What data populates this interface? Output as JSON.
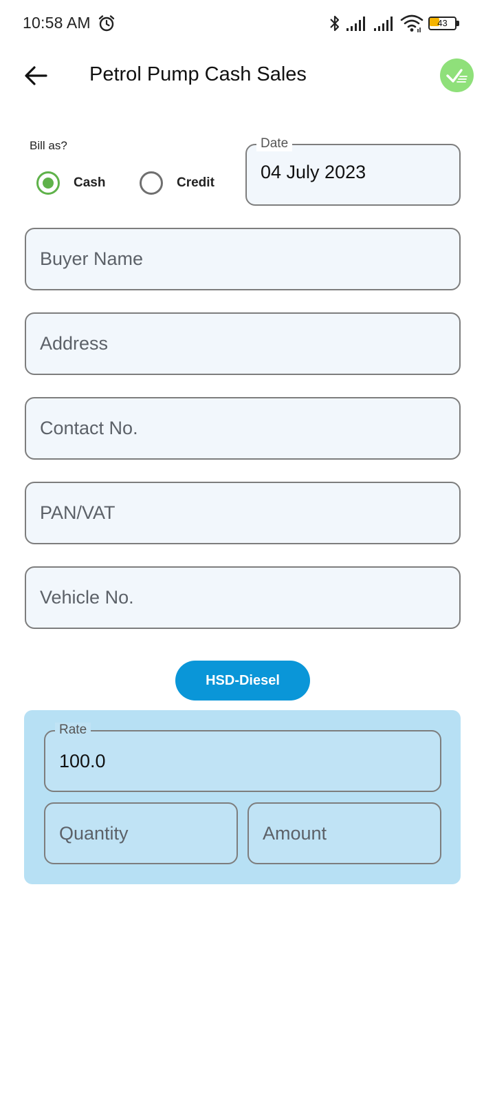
{
  "status_bar": {
    "time": "10:58 AM",
    "battery_level": "43",
    "battery_fraction": 0.43,
    "icons": [
      "alarm-icon",
      "bluetooth-icon",
      "signal-icon",
      "signal-icon",
      "wifi-icon",
      "battery-icon"
    ]
  },
  "app_bar": {
    "title": "Petrol Pump Cash Sales",
    "back_icon": "arrow-left-icon",
    "save_icon": "check-done-icon",
    "save_color": "#8fe07a"
  },
  "form": {
    "bill_as_label": "Bill as?",
    "bill_options": [
      {
        "label": "Cash",
        "selected": true
      },
      {
        "label": "Credit",
        "selected": false
      }
    ],
    "date": {
      "label": "Date",
      "value": "04 July 2023"
    },
    "buyer_name": {
      "placeholder": "Buyer Name"
    },
    "address": {
      "placeholder": "Address"
    },
    "contact_no": {
      "placeholder": "Contact No."
    },
    "pan_vat": {
      "placeholder": "PAN/VAT"
    },
    "vehicle_no": {
      "placeholder": "Vehicle No."
    }
  },
  "product": {
    "chip_label": "HSD-Diesel",
    "chip_color": "#0a96d8",
    "rate": {
      "label": "Rate",
      "value": "100.0"
    },
    "quantity": {
      "placeholder": "Quantity"
    },
    "amount": {
      "placeholder": "Amount"
    }
  },
  "colors": {
    "accent_green": "#5fb24a",
    "panel_blue": "#b7e0f4",
    "field_bg": "#f2f7fc"
  }
}
